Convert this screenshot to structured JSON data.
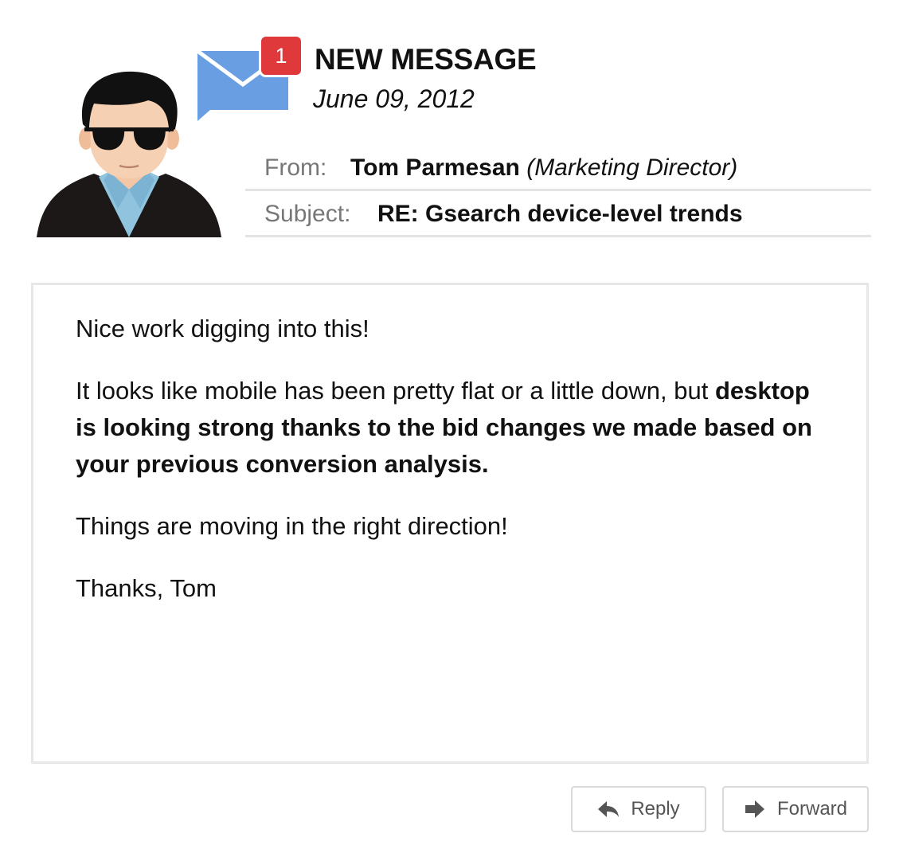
{
  "header": {
    "badge_count": "1",
    "title": "NEW MESSAGE",
    "date": "June 09, 2012",
    "envelope_color": "#6a9ee3",
    "badge_color": "#e0393b"
  },
  "meta": {
    "from_label": "From:",
    "from_name": "Tom Parmesan",
    "from_role": "(Marketing Director)",
    "subject_label": "Subject:",
    "subject_value": "RE: Gsearch device-level trends"
  },
  "body": {
    "p1": "Nice work digging into this!",
    "p2_plain": "It looks like mobile has been pretty flat or a little down, but",
    "p2_bold": "desktop is looking strong thanks to the bid changes we made based on your previous conversion analysis.",
    "p3": "Things are moving in the right direction!",
    "p4": "Thanks, Tom"
  },
  "actions": {
    "reply_label": "Reply",
    "reply_icon": "reply-arrow-icon",
    "forward_label": "Forward",
    "forward_icon": "forward-arrow-icon"
  }
}
